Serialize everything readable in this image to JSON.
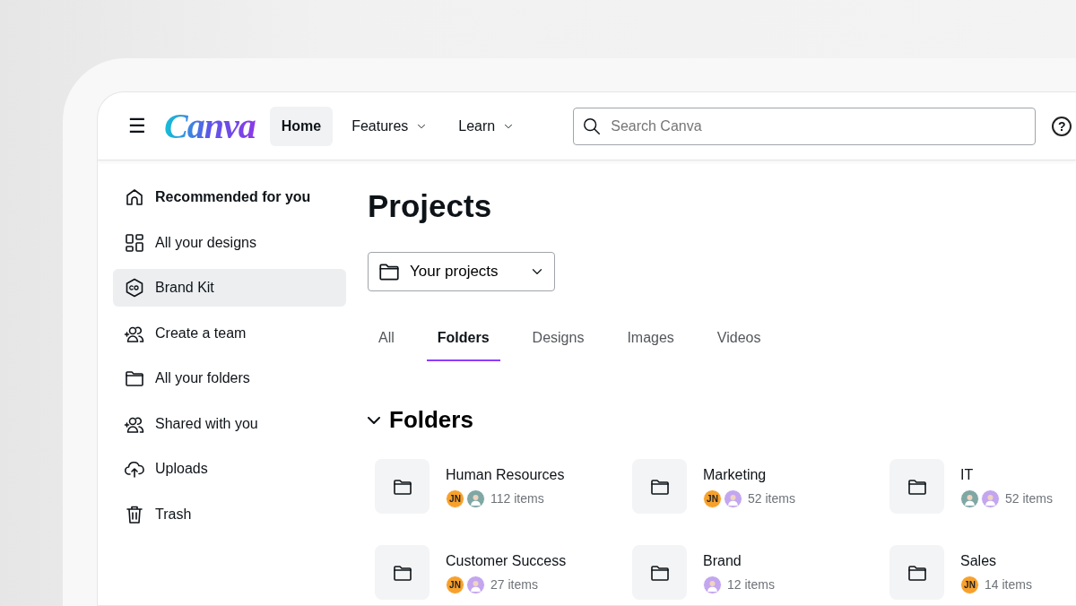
{
  "header": {
    "menu_label": "☰",
    "logo": "Canva",
    "nav": [
      {
        "label": "Home",
        "selected": true,
        "dropdown": false
      },
      {
        "label": "Features",
        "selected": false,
        "dropdown": true
      },
      {
        "label": "Learn",
        "selected": false,
        "dropdown": true
      }
    ],
    "search": {
      "placeholder": "Search Canva"
    },
    "help_label": "?"
  },
  "sidebar": {
    "items": [
      {
        "label": "Recommended for you",
        "emphasized": true,
        "selected": false
      },
      {
        "label": "All your designs",
        "emphasized": false,
        "selected": false
      },
      {
        "label": "Brand Kit",
        "emphasized": false,
        "selected": true
      },
      {
        "label": "Create a team",
        "emphasized": false,
        "selected": false
      },
      {
        "label": "All your folders",
        "emphasized": false,
        "selected": false
      },
      {
        "label": "Shared with you",
        "emphasized": false,
        "selected": false
      },
      {
        "label": "Uploads",
        "emphasized": false,
        "selected": false
      },
      {
        "label": "Trash",
        "emphasized": false,
        "selected": false
      }
    ]
  },
  "main": {
    "title": "Projects",
    "filter": {
      "value": "Your projects"
    },
    "tabs": [
      {
        "label": "All",
        "selected": false
      },
      {
        "label": "Folders",
        "selected": true
      },
      {
        "label": "Designs",
        "selected": false
      },
      {
        "label": "Images",
        "selected": false
      },
      {
        "label": "Videos",
        "selected": false
      }
    ],
    "section": {
      "title": "Folders",
      "expanded": true
    },
    "folders": [
      {
        "name": "Human Resources",
        "count": "112 items",
        "avatars": [
          {
            "kind": "initials",
            "text": "JN",
            "color": "#f7a12c"
          },
          {
            "kind": "person",
            "color": "#7fa7a4"
          }
        ]
      },
      {
        "name": "Marketing",
        "count": "52 items",
        "avatars": [
          {
            "kind": "initials",
            "text": "JN",
            "color": "#f7a12c"
          },
          {
            "kind": "person",
            "color": "#c3a6ef"
          }
        ]
      },
      {
        "name": "IT",
        "count": "52 items",
        "avatars": [
          {
            "kind": "person",
            "color": "#7fa7a4"
          },
          {
            "kind": "person",
            "color": "#c3a6ef"
          }
        ]
      },
      {
        "name": "Customer Success",
        "count": "27 items",
        "avatars": [
          {
            "kind": "initials",
            "text": "JN",
            "color": "#f7a12c"
          },
          {
            "kind": "person",
            "color": "#c3a6ef"
          }
        ]
      },
      {
        "name": "Brand",
        "count": "12 items",
        "avatars": [
          {
            "kind": "person",
            "color": "#c3a6ef"
          }
        ]
      },
      {
        "name": "Sales",
        "count": "14 items",
        "avatars": [
          {
            "kind": "initials",
            "text": "JN",
            "color": "#f7a12c"
          }
        ]
      }
    ]
  }
}
